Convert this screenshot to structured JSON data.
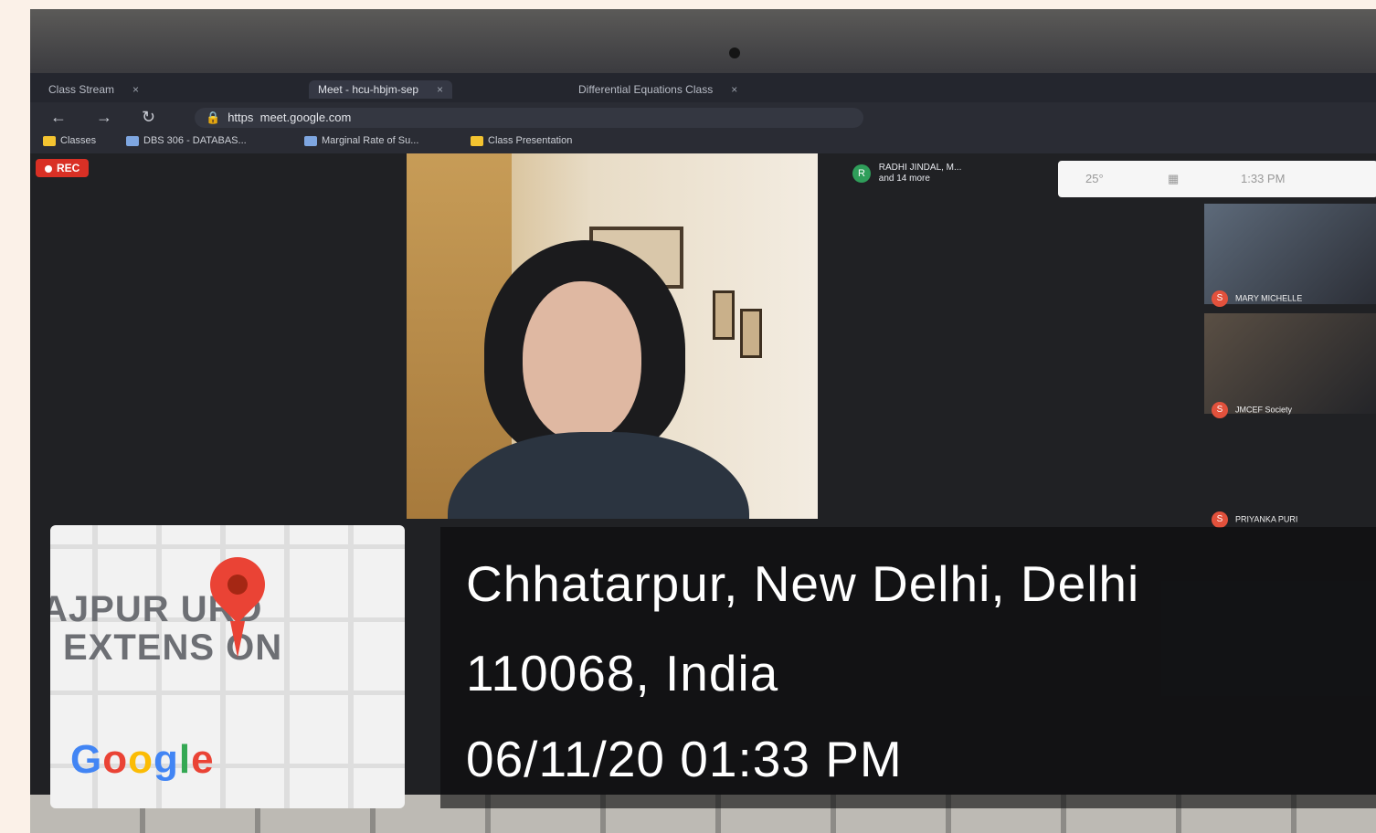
{
  "browser": {
    "tabs": [
      {
        "label": "Class Stream",
        "active": false
      },
      {
        "label": "Meet - hcu-hbjm-sep",
        "active": true
      },
      {
        "label": "Differential Equations Class",
        "active": false
      }
    ],
    "url_scheme": "https",
    "url": "meet.google.com",
    "bookmarks": [
      "Classes",
      "DBS 306 - DATABAS...",
      "Marginal Rate of Su...",
      "Class Presentation"
    ]
  },
  "meet": {
    "rec_label": "REC",
    "pinned_name": "RADHI JINDAL, M...",
    "pinned_sub": "and 14 more",
    "widget": {
      "temp": "25°",
      "time": "1:33 PM"
    },
    "side_tiles": [
      {
        "badge": "S",
        "name": "MARY MICHELLE"
      },
      {
        "badge": "S",
        "name": "JMCEF Society"
      },
      {
        "badge": "S",
        "name": "PRIYANKA PURI"
      }
    ]
  },
  "map": {
    "place_line1": "AJPUR  URD",
    "place_line2": "EXTENS ON",
    "logo": "Google",
    "pin_color": "#ea4335"
  },
  "stamp": {
    "line1": "Chhatarpur, New Delhi, Delhi",
    "line2": "110068, India",
    "line3": "06/11/20 01:33 PM"
  }
}
